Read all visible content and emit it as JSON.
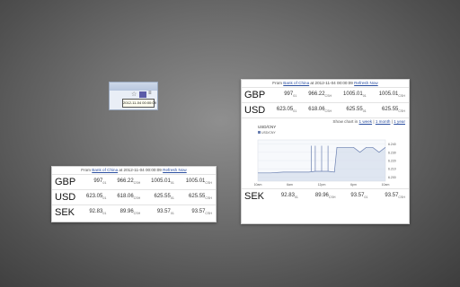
{
  "popup": {
    "tooltip": "2012-11-04 00:00:09"
  },
  "small_card": {
    "source_prefix": "From",
    "source_link": "Bank of China",
    "source_mid": "at 2012-11-04 00:00:09",
    "refresh_label": "Refresh Now",
    "rows": [
      {
        "code": "GBP",
        "v1": "997",
        "s1": "01",
        "v2": "966.22",
        "s2": "CSH",
        "v3": "1005.01",
        "s3": "01",
        "v4": "1005.01",
        "s4": "CSH"
      },
      {
        "code": "USD",
        "v1": "623.05",
        "s1": "01",
        "v2": "618.06",
        "s2": "CSH",
        "v3": "625.55",
        "s3": "01",
        "v4": "625.55",
        "s4": "CSH"
      },
      {
        "code": "SEK",
        "v1": "92.83",
        "s1": "01",
        "v2": "89.96",
        "s2": "CSH",
        "v3": "93.57",
        "s3": "01",
        "v4": "93.57",
        "s4": "CSH"
      }
    ]
  },
  "large_card": {
    "source_prefix": "From",
    "source_link": "Bank of China",
    "source_mid": "at 2012-11-04 00:00:09",
    "refresh_label": "Refresh Now",
    "top_rows": [
      {
        "code": "GBP",
        "v1": "997",
        "s1": "01",
        "v2": "966.22",
        "s2": "CSH",
        "v3": "1005.01",
        "s3": "01",
        "v4": "1005.01",
        "s4": "CSH"
      },
      {
        "code": "USD",
        "v1": "623.05",
        "s1": "01",
        "v2": "618.06",
        "s2": "CSH",
        "v3": "625.55",
        "s3": "01",
        "v4": "625.55",
        "s4": "CSH"
      }
    ],
    "show_chart": {
      "prefix": "Show chart in",
      "week": "1 week",
      "sep1": "|",
      "month": "1 month",
      "sep2": "|",
      "year": "1 year"
    },
    "bottom_row": {
      "code": "SEK",
      "v1": "92.83",
      "s1": "01",
      "v2": "89.96",
      "s2": "CSH",
      "v3": "93.57",
      "s3": "01",
      "v4": "93.57",
      "s4": "CSH"
    }
  },
  "chart_data": {
    "type": "line",
    "title": "USD/CNY",
    "legend": [
      "USD/CNY"
    ],
    "x_ticks": [
      "10am",
      "6am",
      "12pm",
      "6pm",
      "10am"
    ],
    "y_ticks": [
      "6.240",
      "6.230",
      "6.220",
      "6.210",
      "6.200"
    ],
    "ylim": [
      6.195,
      6.245
    ],
    "series": [
      {
        "name": "USD/CNY",
        "color": "#6a7fb0",
        "x": [
          0,
          0.1,
          0.2,
          0.3,
          0.4,
          0.45,
          0.5,
          0.55,
          0.6,
          0.62,
          0.65,
          0.7,
          0.75,
          0.8,
          0.85,
          0.9,
          0.95,
          1.0
        ],
        "values": [
          6.205,
          6.205,
          6.206,
          6.206,
          6.206,
          6.207,
          6.207,
          6.207,
          6.206,
          6.236,
          6.236,
          6.236,
          6.236,
          6.23,
          6.236,
          6.236,
          6.23,
          6.236
        ]
      }
    ],
    "grid": true
  }
}
